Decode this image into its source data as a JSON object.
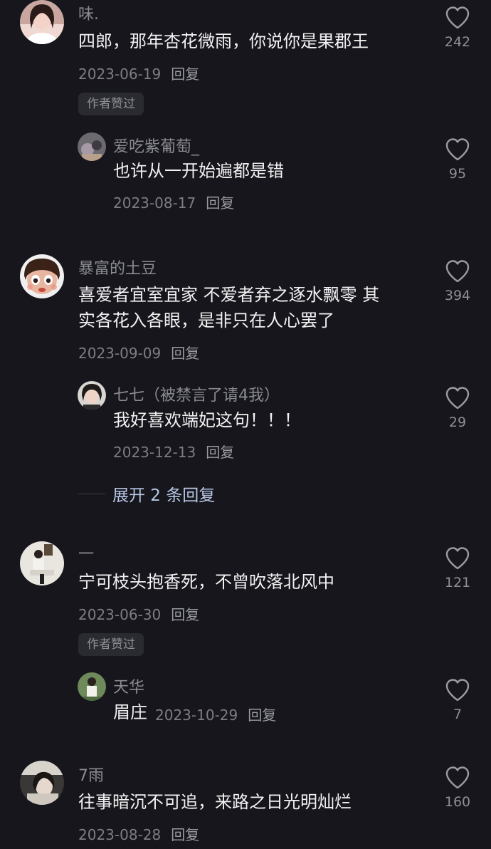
{
  "colors": {
    "background": "#16161c",
    "username": "#8a8a92",
    "content": "#f2f2f2",
    "meta": "#7d7d85",
    "badge_bg": "#2a2a31",
    "expand_link": "#b8c8e6"
  },
  "reply_label": "回复",
  "comments": [
    {
      "username": "味.",
      "text": "四郎，那年杏花微雨，你说你是果郡王",
      "date": "2023-06-19",
      "likes": "242",
      "badge": "作者赞过",
      "avatar_icon": "user-avatar-photo"
    },
    {
      "username": "爱吃紫葡萄_",
      "text": "也许从一开始遍都是错",
      "date": "2023-08-17",
      "likes": "95",
      "avatar_icon": "user-avatar-photo"
    },
    {
      "username": "暴富的土豆",
      "text_line1": "喜爱者宜室宜家 不爱者弃之逐水飘零 其",
      "text_line2": "实各花入各眼，是非只在人心罢了",
      "date": "2023-09-09",
      "likes": "394",
      "avatar_icon": "cartoon-avatar"
    },
    {
      "username": "七七（被禁言了请4我）",
      "text": "我好喜欢端妃这句！！！",
      "date": "2023-12-13",
      "likes": "29",
      "avatar_icon": "user-avatar-photo"
    },
    {
      "username": "一",
      "text": "宁可枝头抱香死，不曾吹落北风中",
      "date": "2023-06-30",
      "likes": "121",
      "badge": "作者赞过",
      "avatar_icon": "user-avatar-photo"
    },
    {
      "username": "天华",
      "text": "眉庄",
      "date": "2023-10-29",
      "likes": "7",
      "avatar_icon": "user-avatar-photo"
    },
    {
      "username": "7雨",
      "text": "往事暗沉不可追，来路之日光明灿烂",
      "date": "2023-08-28",
      "likes": "160",
      "avatar_icon": "user-avatar-photo"
    }
  ],
  "expand_replies": "展开 2 条回复"
}
